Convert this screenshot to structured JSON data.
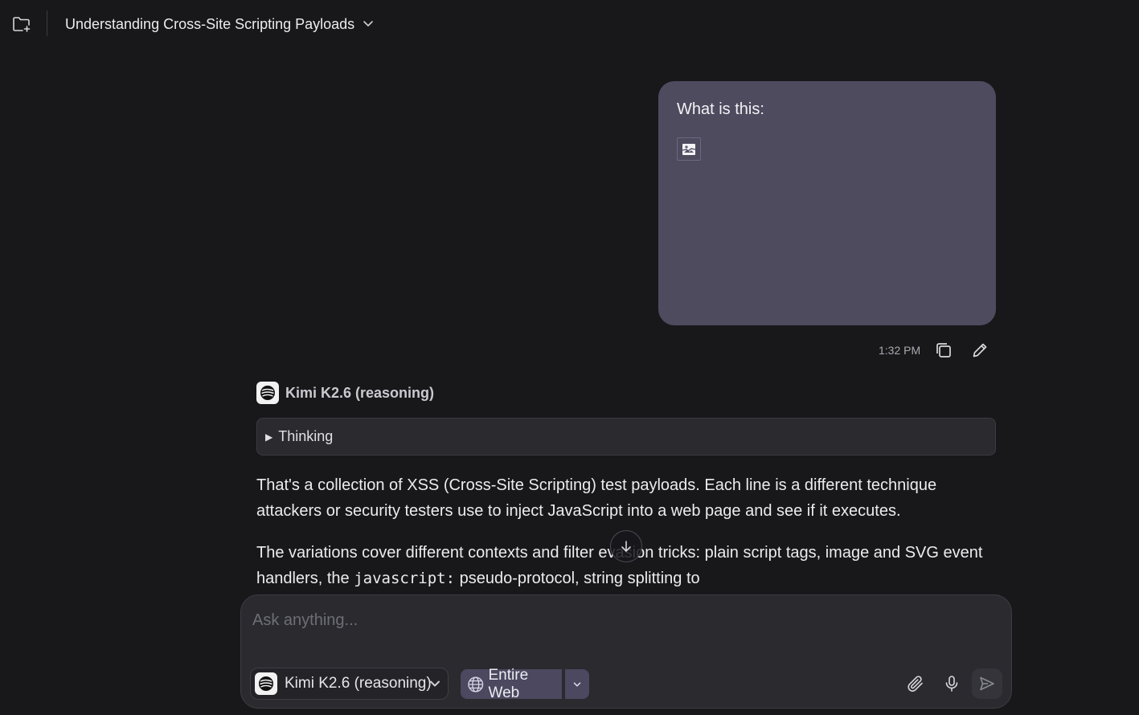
{
  "header": {
    "title": "Understanding Cross-Site Scripting Payloads",
    "icons": {
      "new_folder": "folder-plus-icon",
      "title_dropdown": "chevron-down-icon"
    }
  },
  "user_message": {
    "text": "What is this:",
    "attachment_icon": "broken-image-icon",
    "timestamp": "1:32 PM"
  },
  "assistant": {
    "model_name": "Kimi K2.6 (reasoning)",
    "thinking_label": "Thinking",
    "paragraphs": {
      "p1": "That's a collection of XSS (Cross-Site Scripting) test payloads. Each line is a different technique attackers or security testers use to inject JavaScript into a web page and see if it executes.",
      "p2_before": "The variations cover different contexts and filter evasion tricks: plain script tags, image and SVG event handlers, the ",
      "p2_code": "javascript:",
      "p2_after": " pseudo-protocol, string splitting to"
    }
  },
  "composer": {
    "placeholder": "Ask anything...",
    "model_select_label": "Kimi K2.6 (reasoning)",
    "search_scope_label": "Entire Web"
  },
  "colors": {
    "background": "#18181b",
    "user_bubble": "#4e4b5f",
    "composer_bg": "#2a2a2f",
    "accent_button": "#4b4860"
  }
}
